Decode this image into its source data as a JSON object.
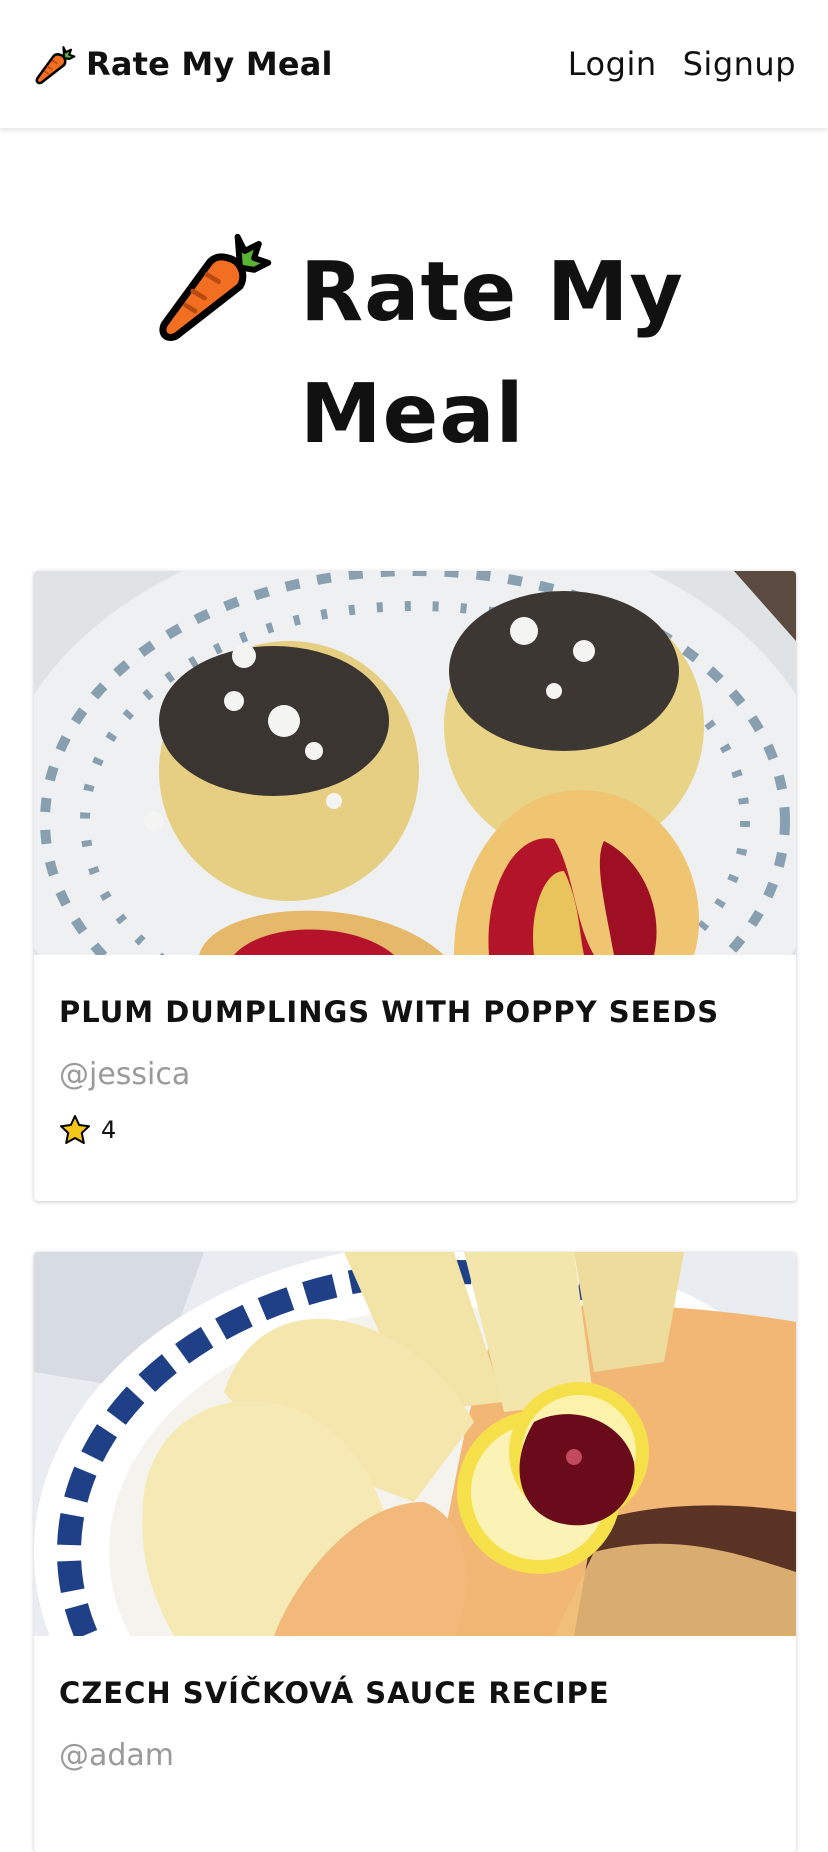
{
  "navbar": {
    "brand": "Rate My Meal",
    "brand_icon": "carrot-icon",
    "links": {
      "login": "Login",
      "signup": "Signup"
    }
  },
  "hero": {
    "title": "Rate My Meal",
    "icon": "carrot-icon"
  },
  "meals": [
    {
      "title": "PLUM DUMPLINGS WITH POPPY SEEDS",
      "author": "@jessica",
      "rating": 4,
      "rating_label": "4",
      "image": "plum-dumplings-photo"
    },
    {
      "title": "CZECH SVÍČKOVÁ SAUCE RECIPE",
      "author": "@adam",
      "image": "svickova-sauce-photo"
    }
  ],
  "colors": {
    "carrot": "#f26f21",
    "carrot_leaves": "#5bb336",
    "star": "#f5c518",
    "author_text": "#9a9a9a"
  }
}
